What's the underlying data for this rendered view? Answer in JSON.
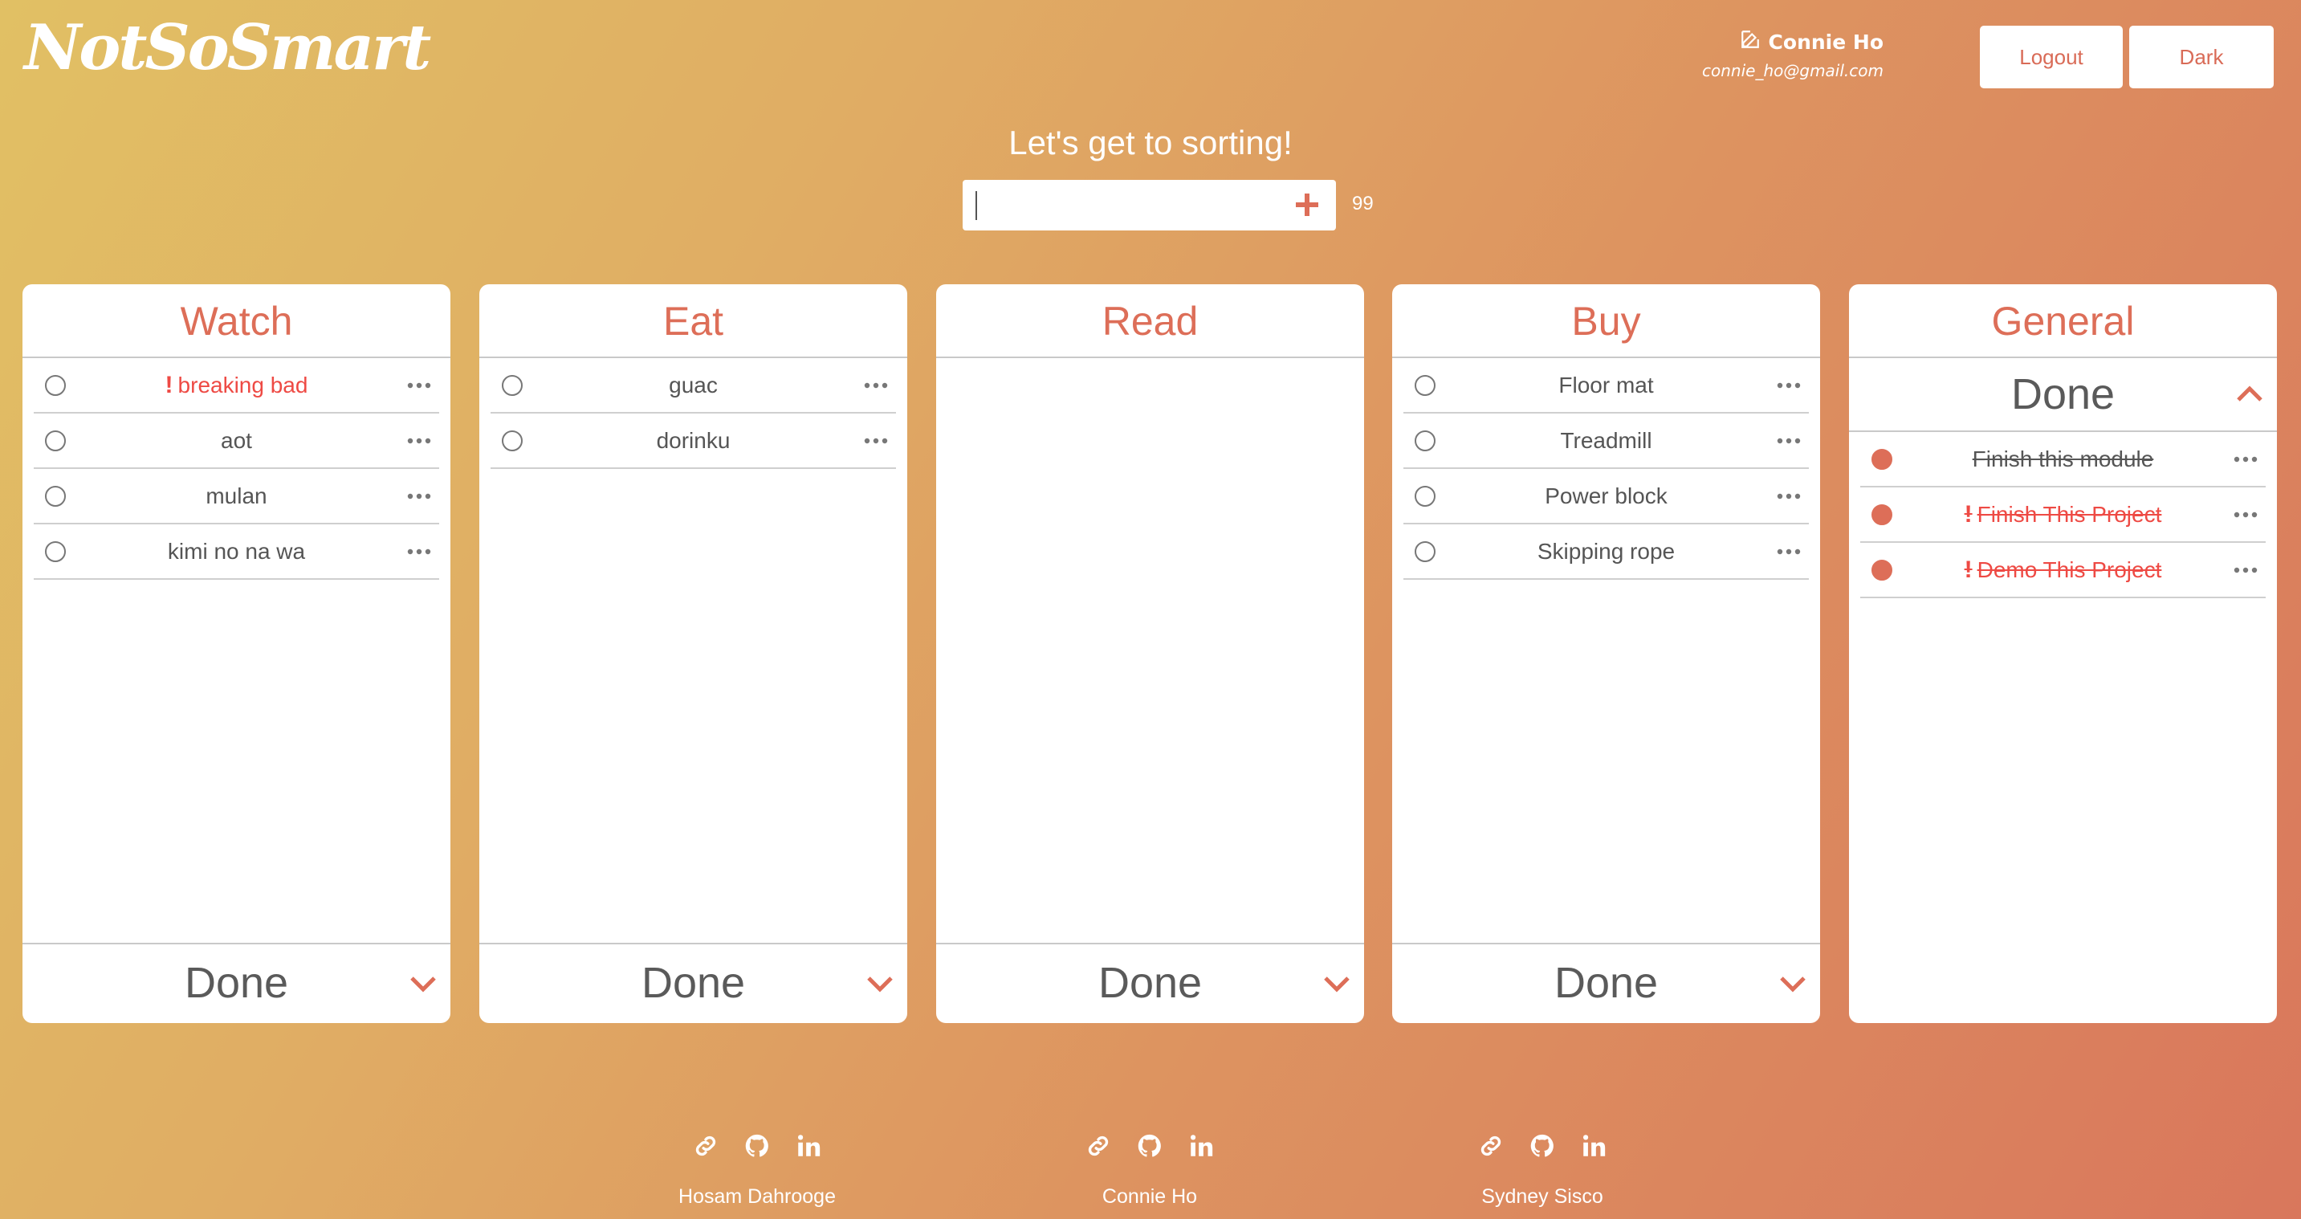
{
  "app": {
    "logo": "NotSoSmart"
  },
  "user": {
    "name": "Connie Ho",
    "email": "connie_ho@gmail.com"
  },
  "header": {
    "logout_label": "Logout",
    "theme_label": "Dark"
  },
  "tagline": "Let's get to sorting!",
  "add_task": {
    "value": "",
    "placeholder": "",
    "char_count": "99"
  },
  "colors": {
    "accent": "#dd6e58",
    "urgent": "#ee4a44"
  },
  "columns": [
    {
      "title": "Watch",
      "tasks": [
        {
          "text": "breaking bad",
          "urgent": true
        },
        {
          "text": "aot",
          "urgent": false
        },
        {
          "text": "mulan",
          "urgent": false
        },
        {
          "text": "kimi no na wa",
          "urgent": false
        }
      ],
      "done_label": "Done",
      "done_expanded": false
    },
    {
      "title": "Eat",
      "tasks": [
        {
          "text": "guac",
          "urgent": false
        },
        {
          "text": "dorinku",
          "urgent": false
        }
      ],
      "done_label": "Done",
      "done_expanded": false
    },
    {
      "title": "Read",
      "tasks": [],
      "done_label": "Done",
      "done_expanded": false
    },
    {
      "title": "Buy",
      "tasks": [
        {
          "text": "Floor mat",
          "urgent": false
        },
        {
          "text": "Treadmill",
          "urgent": false
        },
        {
          "text": "Power block",
          "urgent": false
        },
        {
          "text": "Skipping rope",
          "urgent": false
        }
      ],
      "done_label": "Done",
      "done_expanded": false
    },
    {
      "title": "General",
      "tasks": [
        {
          "text": "Finish this module",
          "urgent": false,
          "done": true
        },
        {
          "text": "Finish This Project",
          "urgent": true,
          "done": true
        },
        {
          "text": "Demo This Project",
          "urgent": true,
          "done": true
        }
      ],
      "done_label": "Done",
      "done_expanded": true
    }
  ],
  "footer": [
    {
      "name": "Hosam Dahrooge",
      "icons": [
        "link-icon",
        "github-icon",
        "linkedin-icon"
      ]
    },
    {
      "name": "Connie Ho",
      "icons": [
        "link-icon",
        "github-icon",
        "linkedin-icon"
      ]
    },
    {
      "name": "Sydney Sisco",
      "icons": [
        "link-icon",
        "github-icon",
        "linkedin-icon"
      ]
    }
  ]
}
